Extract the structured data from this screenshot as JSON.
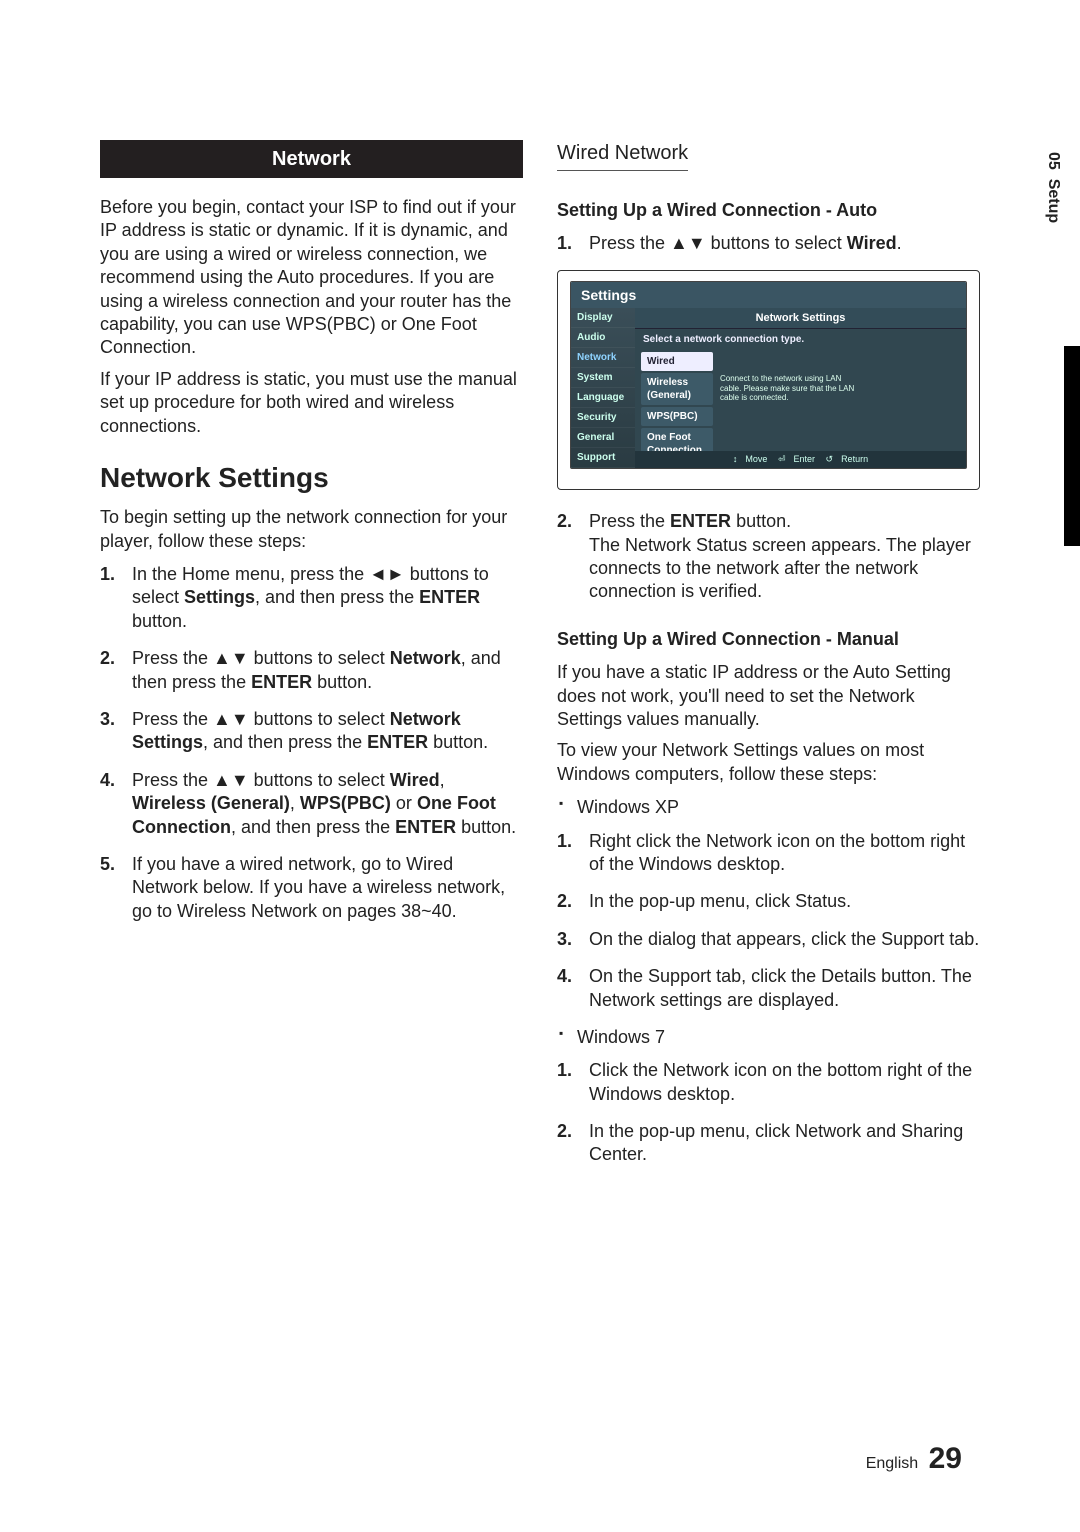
{
  "side": {
    "chapter": "05",
    "title": "Setup"
  },
  "left": {
    "band": "Network",
    "p1": "Before you begin, contact your ISP to find out if your IP address is static or dynamic. If it is dynamic, and you are using a wired or wireless connection, we recommend using the Auto procedures. If you are using a wireless connection and your router has the capability, you can use WPS(PBC) or One Foot Connection.",
    "p2": "If your IP address is static, you must use the manual set up procedure for both wired and wireless connections.",
    "h2": "Network Settings",
    "p3": "To begin setting up the network connection for your player, follow these steps:",
    "s1a": "In the Home menu, press the ◄► buttons to select ",
    "s1b": "Settings",
    "s1c": ", and then press the ",
    "s1d": "ENTER",
    "s1e": " button.",
    "s2a": "Press the ▲▼ buttons to select ",
    "s2b": "Network",
    "s2c": ", and then press the ",
    "s2d": "ENTER",
    "s2e": " button.",
    "s3a": "Press the ▲▼ buttons to select ",
    "s3b": "Network Settings",
    "s3c": ", and then press the ",
    "s3d": "ENTER",
    "s3e": " button.",
    "s4a": "Press the ▲▼ buttons to select ",
    "s4b": "Wired",
    "s4c": ", ",
    "s4d": "Wireless (General)",
    "s4e": ", ",
    "s4f": "WPS(PBC)",
    "s4g": " or ",
    "s4h": "One Foot Connection",
    "s4i": ", and then press the ",
    "s4j": "ENTER",
    "s4k": " button.",
    "s5": "If you have a wired network, go to Wired Network below. If you have a wireless network, go to Wireless Network on pages 38~40."
  },
  "right": {
    "h3": "Wired Network",
    "h4a": "Setting Up a Wired Connection - Auto",
    "a1a": "Press the ▲▼ buttons to select ",
    "a1b": "Wired",
    "a1c": ".",
    "a2a": "Press the ",
    "a2b": "ENTER",
    "a2c": " button.",
    "a2d": "The Network Status screen appears. The player connects to the network after the network connection is verified.",
    "h4b": "Setting Up a Wired Connection - Manual",
    "mp1": "If you have a static IP address or the Auto Setting does not work, you'll need to set the Network Settings values manually.",
    "mp2": "To view your Network Settings values on most Windows computers, follow these steps:",
    "bxp": "Windows XP",
    "x1": "Right click the Network icon on the bottom right of the Windows desktop.",
    "x2": "In the pop-up menu, click Status.",
    "x3": "On the dialog that appears, click the Support tab.",
    "x4": "On the Support tab, click the Details button. The Network settings are displayed.",
    "bw7": "Windows 7",
    "w1": "Click the Network icon on the bottom right of the Windows desktop.",
    "w2": "In the pop-up menu, click Network and Sharing Center."
  },
  "tv": {
    "topbar": "Settings",
    "menu": [
      "Display",
      "Audio",
      "Network",
      "System",
      "Language",
      "Security",
      "General",
      "Support"
    ],
    "rtitle": "Network Settings",
    "subt": "Select a network connection type.",
    "opts": [
      "Wired",
      "Wireless (General)",
      "WPS(PBC)",
      "One Foot Connection"
    ],
    "hint": "Connect to the network using LAN cable. Please make sure that the LAN cable is connected.",
    "foot": {
      "move": "Move",
      "enter": "Enter",
      "return": "Return"
    }
  },
  "footer": {
    "lang": "English",
    "page": "29"
  }
}
